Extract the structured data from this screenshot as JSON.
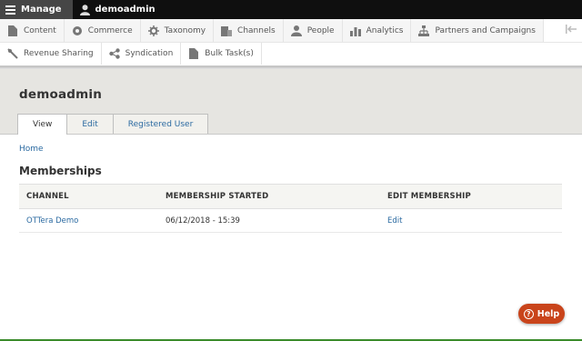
{
  "toolbar": {
    "manage_label": "Manage",
    "user_label": "demoadmin"
  },
  "tray": {
    "row1": [
      {
        "label": "Content",
        "icon": "content-icon"
      },
      {
        "label": "Commerce",
        "icon": "commerce-icon"
      },
      {
        "label": "Taxonomy",
        "icon": "taxonomy-icon"
      },
      {
        "label": "Channels",
        "icon": "channels-icon"
      },
      {
        "label": "People",
        "icon": "people-icon"
      },
      {
        "label": "Analytics",
        "icon": "analytics-icon"
      },
      {
        "label": "Partners and Campaigns",
        "icon": "partners-icon"
      }
    ],
    "row2": [
      {
        "label": "Revenue Sharing",
        "icon": "revenue-icon"
      },
      {
        "label": "Syndication",
        "icon": "syndication-icon"
      },
      {
        "label": "Bulk Task(s)",
        "icon": "bulk-tasks-icon"
      }
    ]
  },
  "page": {
    "title": "demoadmin",
    "tabs": [
      "View",
      "Edit",
      "Registered User"
    ],
    "active_tab": "View"
  },
  "breadcrumb": "Home",
  "memberships": {
    "title": "Memberships",
    "columns": [
      "CHANNEL",
      "MEMBERSHIP STARTED",
      "EDIT MEMBERSHIP"
    ],
    "rows": [
      {
        "channel": "OTTera Demo",
        "started": "06/12/2018 - 15:39",
        "edit": "Edit"
      }
    ]
  },
  "help": {
    "label": "Help"
  },
  "colors": {
    "accent_link": "#2b6aa1",
    "help_button": "#c9441b",
    "header_bg": "#e6e5e1"
  }
}
